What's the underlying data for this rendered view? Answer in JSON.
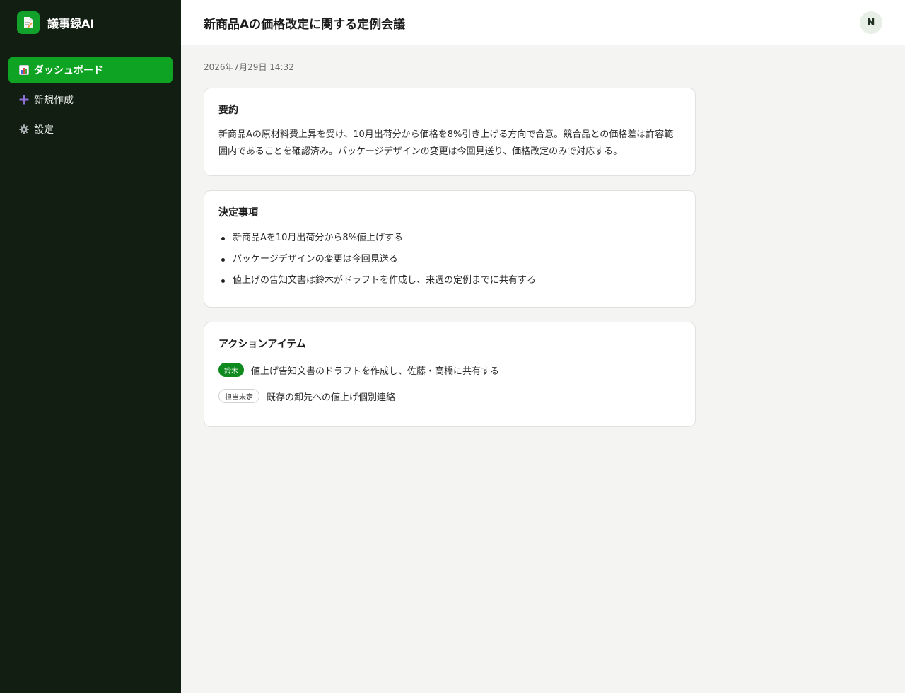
{
  "app": {
    "name": "議事録AI",
    "logo_icon": "document-icon"
  },
  "sidebar": {
    "items": [
      {
        "label": "ダッシュボード",
        "icon": "bar-chart-icon",
        "active": true
      },
      {
        "label": "新規作成",
        "icon": "plus-icon",
        "active": false
      },
      {
        "label": "設定",
        "icon": "gear-icon",
        "active": false
      }
    ]
  },
  "header": {
    "title": "新商品Aの価格改定に関する定例会議",
    "avatar_initial": "N"
  },
  "meeting": {
    "datetime": "2026年7月29日 14:32"
  },
  "summary": {
    "heading": "要約",
    "text": "新商品Aの原材料費上昇を受け、10月出荷分から価格を8%引き上げる方向で合意。競合品との価格差は許容範囲内であることを確認済み。パッケージデザインの変更は今回見送り、価格改定のみで対応する。"
  },
  "decisions": {
    "heading": "決定事項",
    "items": [
      "新商品Aを10月出荷分から8%値上げする",
      "パッケージデザインの変更は今回見送る",
      "値上げの告知文書は鈴木がドラフトを作成し、来週の定例までに共有する"
    ]
  },
  "actions": {
    "heading": "アクションアイテム",
    "items": [
      {
        "assignee": "鈴木",
        "task": "値上げ告知文書のドラフトを作成し、佐藤・高橋に共有する",
        "assigned": true
      },
      {
        "assignee": "担当未定",
        "task": "既存の卸先への値上げ個別連絡",
        "assigned": false
      }
    ]
  },
  "colors": {
    "sidebar_bg": "#121e12",
    "accent_green": "#0ea322",
    "badge_green": "#0e8a1e",
    "page_bg": "#f4f5f3"
  }
}
